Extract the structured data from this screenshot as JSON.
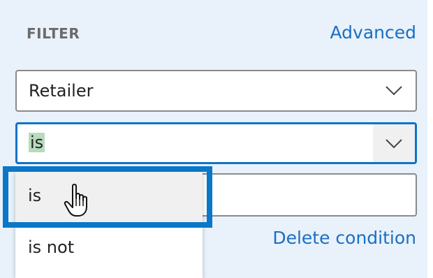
{
  "filter": {
    "heading": "FILTER",
    "advanced_link": "Advanced",
    "field_select": {
      "value": "Retailer"
    },
    "operator_select": {
      "value": "is"
    },
    "value_input": {
      "value": ""
    },
    "operator_options": [
      "is",
      "is not"
    ],
    "delete_link": "Delete condition"
  },
  "colors": {
    "accent": "#0f73c6",
    "link": "#1a6fc2",
    "panel_bg": "#e9f1fb",
    "selection_highlight": "#b7dbbd"
  },
  "icons": {
    "dropdown": "chevron-down-icon",
    "pointer": "hand-pointer-icon"
  }
}
